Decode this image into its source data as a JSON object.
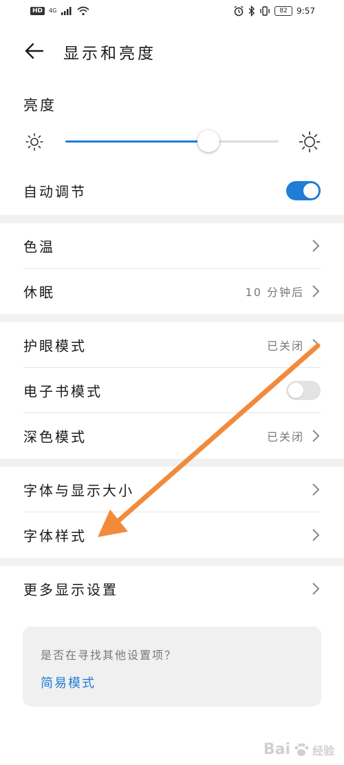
{
  "status_bar": {
    "hd": "HD",
    "network": "4G",
    "battery": "82",
    "time": "9:57"
  },
  "header": {
    "title": "显示和亮度"
  },
  "brightness": {
    "title": "亮度",
    "level": 0.67
  },
  "rows": {
    "auto_adjust": {
      "label": "自动调节",
      "on": true
    },
    "color_temp": {
      "label": "色温"
    },
    "sleep": {
      "label": "休眠",
      "value": "10 分钟后"
    },
    "eye_comfort": {
      "label": "护眼模式",
      "value": "已关闭"
    },
    "ebook_mode": {
      "label": "电子书模式",
      "on": false
    },
    "dark_mode": {
      "label": "深色模式",
      "value": "已关闭"
    },
    "font_size": {
      "label": "字体与显示大小"
    },
    "font_style": {
      "label": "字体样式"
    },
    "more": {
      "label": "更多显示设置"
    }
  },
  "help": {
    "question": "是否在寻找其他设置项？",
    "link": "简易模式"
  },
  "watermark": {
    "text": "Bai",
    "suffix": "经验"
  },
  "colors": {
    "accent": "#1f7dd6",
    "annotation_arrow": "#f28a3c"
  }
}
